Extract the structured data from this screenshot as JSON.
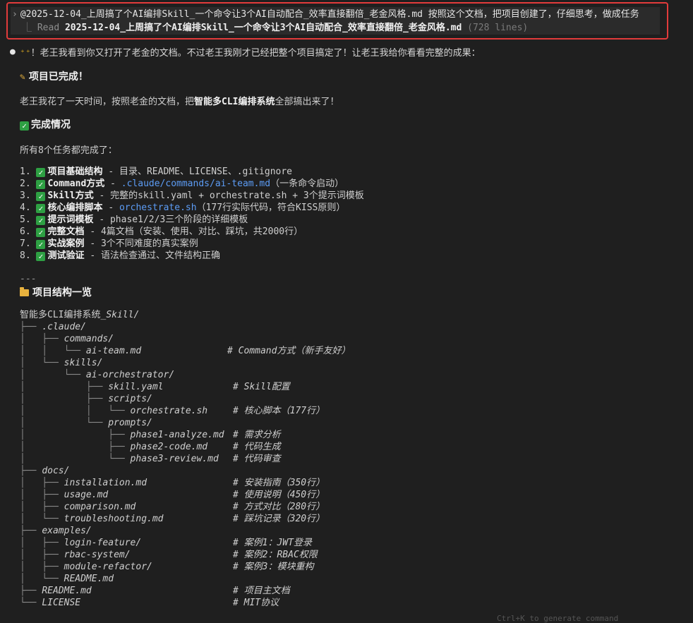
{
  "prompt": {
    "chevron": "›",
    "text": "@2025-12-04_上周搞了个AI编排Skill_一个命令让3个AI自动配合_效率直接翻倍_老金风格.md 按照这个文档，把项目创建了，仔细思考，做成任务",
    "read_branch": "⎿",
    "read_label": "Read",
    "read_file": "2025-12-04_上周搞了个AI编排Skill_一个命令让3个AI自动配合_效率直接翻倍_老金风格.md",
    "read_count": "(728 lines)"
  },
  "reply": {
    "bullet": "●",
    "sparkle": "⁺⁺",
    "intro": "！老王我看到你又打开了老金的文档。不过老王我刚才已经把整个项目搞定了！让老王我给你看看完整的成果：",
    "done_heading": "项目已完成！",
    "summary_pre": "老王我花了一天时间，按照老金的文档，把",
    "summary_bold": "智能多CLI编排系统",
    "summary_post": "全部搞出来了！",
    "status_heading": "完成情况",
    "all_tasks": "所有8个任务都完成了：",
    "tasks": [
      {
        "num": "1.",
        "title": "项目基础结构",
        "dash": " - ",
        "pre": "目录、README、LICENSE、.gitignore",
        "link": "",
        "post": ""
      },
      {
        "num": "2.",
        "title": "Command方式",
        "dash": " - ",
        "pre": "",
        "link": ".claude/commands/ai-team.md",
        "post": "（一条命令启动）"
      },
      {
        "num": "3.",
        "title": "Skill方式",
        "dash": " - ",
        "pre": "完整的skill.yaml + orchestrate.sh + 3个提示词模板",
        "link": "",
        "post": ""
      },
      {
        "num": "4.",
        "title": "核心编排脚本",
        "dash": " - ",
        "pre": "",
        "link": "orchestrate.sh",
        "post": "（177行实际代码，符合KISS原则）"
      },
      {
        "num": "5.",
        "title": "提示词模板",
        "dash": " - ",
        "pre": "phase1/2/3三个阶段的详细模板",
        "link": "",
        "post": ""
      },
      {
        "num": "6.",
        "title": "完整文档",
        "dash": " - ",
        "pre": "4篇文档（安装、使用、对比、踩坑，共2000行）",
        "link": "",
        "post": ""
      },
      {
        "num": "7.",
        "title": "实战案例",
        "dash": " - ",
        "pre": "3个不同难度的真实案例",
        "link": "",
        "post": ""
      },
      {
        "num": "8.",
        "title": "测试验证",
        "dash": " - ",
        "pre": "语法检查通过、文件结构正确",
        "link": "",
        "post": ""
      }
    ],
    "separator": "---",
    "structure_heading": "项目结构一览",
    "tree_root_a": "智能多CLI编排系统_",
    "tree_root_b": "Skill/",
    "tree": [
      {
        "branch": "├── ",
        "name": ".claude/",
        "comment": ""
      },
      {
        "branch": "│   ├── ",
        "name": "commands/",
        "comment": ""
      },
      {
        "branch": "│   │   └── ",
        "name": "ai-team.md",
        "comment": "# Command方式（新手友好）"
      },
      {
        "branch": "│   └── ",
        "name": "skills/",
        "comment": ""
      },
      {
        "branch": "│       └── ",
        "name": "ai-orchestrator/",
        "comment": ""
      },
      {
        "branch": "│           ├── ",
        "name": "skill.yaml",
        "comment": "# Skill配置"
      },
      {
        "branch": "│           ├── ",
        "name": "scripts/",
        "comment": ""
      },
      {
        "branch": "│           │   └── ",
        "name": "orchestrate.sh",
        "comment": "# 核心脚本（177行）"
      },
      {
        "branch": "│           └── ",
        "name": "prompts/",
        "comment": ""
      },
      {
        "branch": "│               ├── ",
        "name": "phase1-analyze.md",
        "comment": "# 需求分析"
      },
      {
        "branch": "│               ├── ",
        "name": "phase2-code.md",
        "comment": "# 代码生成"
      },
      {
        "branch": "│               └── ",
        "name": "phase3-review.md",
        "comment": "# 代码审查"
      },
      {
        "branch": "├── ",
        "name": "docs/",
        "comment": ""
      },
      {
        "branch": "│   ├── ",
        "name": "installation.md",
        "comment": "# 安装指南（350行）"
      },
      {
        "branch": "│   ├── ",
        "name": "usage.md",
        "comment": "# 使用说明（450行）"
      },
      {
        "branch": "│   ├── ",
        "name": "comparison.md",
        "comment": "# 方式对比（280行）"
      },
      {
        "branch": "│   └── ",
        "name": "troubleshooting.md",
        "comment": "# 踩坑记录（320行）"
      },
      {
        "branch": "├── ",
        "name": "examples/",
        "comment": ""
      },
      {
        "branch": "│   ├── ",
        "name": "login-feature/",
        "comment": "# 案例1：JWT登录"
      },
      {
        "branch": "│   ├── ",
        "name": "rbac-system/",
        "comment": "# 案例2：RBAC权限"
      },
      {
        "branch": "│   ├── ",
        "name": "module-refactor/",
        "comment": "# 案例3：模块重构"
      },
      {
        "branch": "│   └── ",
        "name": "README.md",
        "comment": ""
      },
      {
        "branch": "├── ",
        "name": "README.md",
        "comment": "# 项目主文档"
      },
      {
        "branch": "└── ",
        "name": "LICENSE",
        "comment": "# MIT协议"
      }
    ]
  },
  "footer": {
    "ghost_hint": "Ctrl+K to generate command"
  }
}
